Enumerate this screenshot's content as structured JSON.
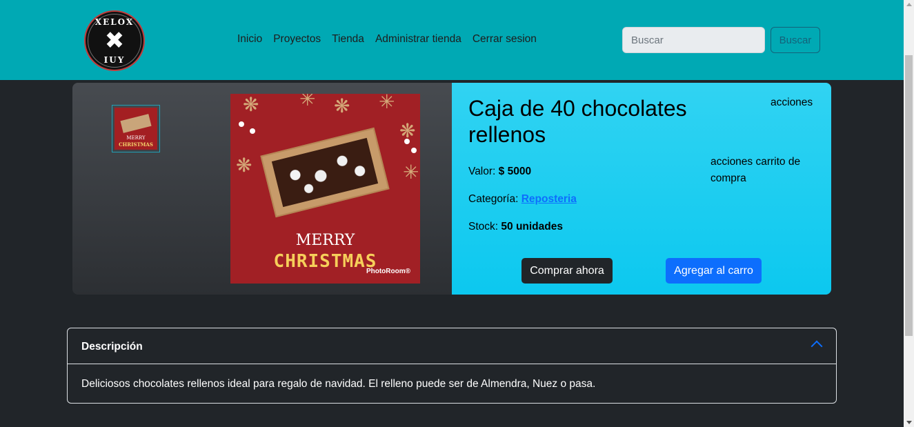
{
  "navbar": {
    "logo": {
      "top_text": "XELOX",
      "center_mark": "✖",
      "bottom_text": "IUY"
    },
    "links": [
      "Inicio",
      "Proyectos",
      "Tienda",
      "Administrar tienda",
      "Cerrar sesion"
    ],
    "search": {
      "placeholder": "Buscar",
      "button_label": "Buscar"
    },
    "colors": {
      "background": "#00a9b4"
    }
  },
  "product": {
    "title": "Caja de 40 chocolates rellenos",
    "acciones_label": "acciones",
    "acciones_carrito_label": "acciones carrito de compra",
    "valor_label": "Valor:",
    "valor_value": "$ 5000",
    "categoria_label": "Categoría:",
    "categoria_value": "Reposteria",
    "stock_label": "Stock:",
    "stock_value": "50 unidades",
    "buy_button": "Comprar ahora",
    "cart_button": "Agregar al carro",
    "image": {
      "line1": "MERRY",
      "line2": "CHRISTMAS",
      "watermark": "PhotoRoom®"
    },
    "thumbnail": {
      "line1": "MERRY",
      "line2": "CHRISTMAS"
    },
    "colors": {
      "info_bg": "#0dcaf0",
      "buy_button_bg": "#212529",
      "cart_button_bg": "#0d6efd",
      "link": "#0d6efd"
    }
  },
  "accordion": {
    "title": "Descripción",
    "body": "Deliciosos chocolates rellenos ideal para regalo de navidad. El relleno puede ser de Almendra, Nuez o pasa.",
    "expanded": true
  },
  "page": {
    "background": "#212529"
  }
}
